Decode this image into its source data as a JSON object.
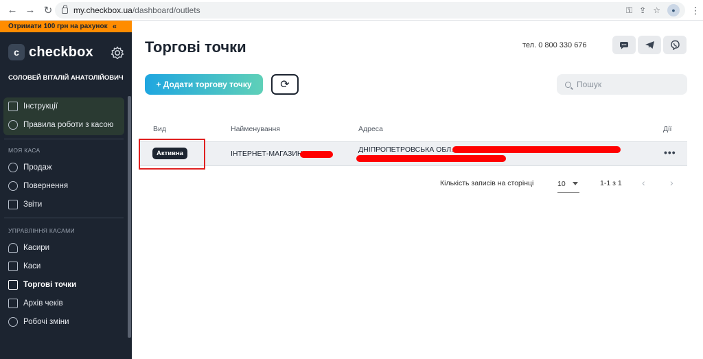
{
  "browser": {
    "url_host": "my.checkbox.ua",
    "url_path": "/dashboard/outlets"
  },
  "sidebar": {
    "promo": "Отримати 100 грн на рахунок",
    "promo_chevron": "«",
    "brand_logo_letter": "c",
    "brand_name": "checkbox",
    "user_name": "СОЛОВЕЙ ВІТАЛІЙ АНАТОЛІЙОВИЧ",
    "help_items": [
      {
        "label": "Інструкції",
        "icon": "book-icon"
      },
      {
        "label": "Правила роботи з касою",
        "icon": "chat-icon"
      }
    ],
    "section_kasa": "МОЯ КАСА",
    "kasa_items": [
      {
        "label": "Продаж",
        "icon": "arrow-right-circle-icon"
      },
      {
        "label": "Повернення",
        "icon": "arrow-left-circle-icon"
      },
      {
        "label": "Звіти",
        "icon": "report-icon"
      }
    ],
    "section_manage": "УПРАВЛІННЯ КАСАМИ",
    "manage_items": [
      {
        "label": "Касири",
        "icon": "users-icon",
        "active": false
      },
      {
        "label": "Каси",
        "icon": "register-icon",
        "active": false
      },
      {
        "label": "Торгові точки",
        "icon": "store-icon",
        "active": true
      },
      {
        "label": "Архів чеків",
        "icon": "receipt-icon",
        "active": false
      },
      {
        "label": "Робочі зміни",
        "icon": "shift-icon",
        "active": false
      }
    ]
  },
  "header": {
    "title": "Торгові точки",
    "phone": "тел. 0 800 330 676"
  },
  "toolbar": {
    "add_label": "+ Додати торгову точку",
    "search_placeholder": "Пошук"
  },
  "table": {
    "columns": [
      "Вид",
      "Найменування",
      "Адреса",
      "Дії"
    ],
    "rows": [
      {
        "status": "Активна",
        "name": "ІНТЕРНЕТ-МАГАЗИН",
        "address": "ДНІПРОПЕТРОВСЬКА ОБЛ.,",
        "actions": "•••"
      }
    ]
  },
  "pagination": {
    "per_page_label": "Кількість записів на сторінці",
    "per_page": "10",
    "range": "1-1 з 1",
    "prev": "‹",
    "next": "›"
  },
  "colors": {
    "sidebar_bg": "#1c2430",
    "promo": "#ff8c00",
    "accent_start": "#1fa6e0",
    "accent_end": "#5fd0b8",
    "redaction": "#ff0000",
    "highlight_border": "#e02020"
  }
}
